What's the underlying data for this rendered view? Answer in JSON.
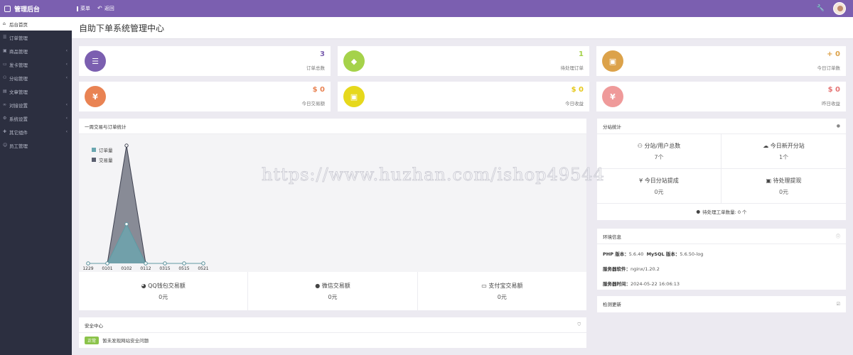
{
  "topbar": {
    "brand": "管理后台",
    "menu_label": "菜单",
    "back_label": "返回"
  },
  "sidebar": {
    "items": [
      {
        "label": "后台首页",
        "icon": "home-icon",
        "active": true
      },
      {
        "label": "订单管理",
        "icon": "list-icon"
      },
      {
        "label": "商品管理",
        "icon": "cart-icon",
        "has_children": true
      },
      {
        "label": "发卡管理",
        "icon": "card-icon",
        "has_children": true
      },
      {
        "label": "分站管理",
        "icon": "sitemap-icon",
        "has_children": true
      },
      {
        "label": "文章管理",
        "icon": "doc-icon"
      },
      {
        "label": "对接设置",
        "icon": "link-icon",
        "has_children": true
      },
      {
        "label": "系统设置",
        "icon": "gear-icon",
        "has_children": true
      },
      {
        "label": "其它组件",
        "icon": "puzzle-icon",
        "has_children": true
      },
      {
        "label": "员工管理",
        "icon": "user-icon"
      }
    ]
  },
  "page_title": "自助下单系统管理中心",
  "stats": [
    {
      "value": "3",
      "label": "订单总数",
      "color": "#7b5fb0",
      "icon": "list-icon"
    },
    {
      "value": "1",
      "label": "待处理订单",
      "color": "#a5d24a",
      "icon": "cube-icon"
    },
    {
      "value": "+ 0",
      "label": "今日订单数",
      "color": "#dca24a",
      "icon": "briefcase-icon"
    },
    {
      "value": "$ 0",
      "label": "今日交易额",
      "color": "#e98353",
      "icon": "yen-icon"
    },
    {
      "value": "$ 0",
      "label": "今日收益",
      "color": "#e6d81c",
      "icon": "briefcase-icon"
    },
    {
      "value": "$ 0",
      "label": "昨日收益",
      "color": "#ef9a9a",
      "icon": "yen-icon"
    }
  ],
  "stat_value_colors": [
    "#7b5fb0",
    "#a5d24a",
    "#dca24a",
    "#e98353",
    "#e6c81c",
    "#e57373"
  ],
  "weekly": {
    "title": "一周交易与订单统计",
    "payments": [
      {
        "label": "QQ钱包交易额",
        "value": "0元",
        "icon": "qq-icon"
      },
      {
        "label": "微信交易额",
        "value": "0元",
        "icon": "wechat-icon"
      },
      {
        "label": "支付宝交易额",
        "value": "0元",
        "icon": "credit-card-icon"
      }
    ]
  },
  "chart_data": {
    "type": "area",
    "categories": [
      "1229",
      "0101",
      "0102",
      "0112",
      "0315",
      "0515",
      "0521"
    ],
    "series": [
      {
        "name": "订单量",
        "values": [
          0,
          0,
          1,
          0,
          0,
          0,
          0
        ],
        "color": "#6aa7b0"
      },
      {
        "name": "交易量",
        "values": [
          0,
          0,
          3,
          0,
          0,
          0,
          0
        ],
        "color": "#5a5e6e"
      }
    ],
    "ylim": [
      0,
      3
    ],
    "legend_position": "top-left",
    "grid": false
  },
  "substations": {
    "title": "分站统计",
    "cells": [
      {
        "label": "分站/用户总数",
        "value": "7个",
        "icon": "sitemap-icon"
      },
      {
        "label": "今日新开分站",
        "value": "1个",
        "icon": "cloud-icon"
      },
      {
        "label": "今日分站提成",
        "value": "0元",
        "icon": "yen-icon"
      },
      {
        "label": "待处理提现",
        "value": "0元",
        "icon": "money-icon"
      }
    ],
    "ticket_label": "待处理工单数量: 0 个"
  },
  "env": {
    "title": "环境信息",
    "php_label": "PHP 版本：",
    "php_value": "5.6.40",
    "mysql_label": "MySQL 版本：",
    "mysql_value": "5.6.50-log",
    "server_label": "服务器软件：",
    "server_value": "nginx/1.20.2",
    "time_label": "服务器时间：",
    "time_value": "2024-05-22 16:06:13"
  },
  "update": {
    "title": "检测更新"
  },
  "security": {
    "title": "安全中心",
    "badge": "正常",
    "message": "暂未发现网站安全问题"
  },
  "watermark": "https://www.huzhan.com/ishop49544"
}
